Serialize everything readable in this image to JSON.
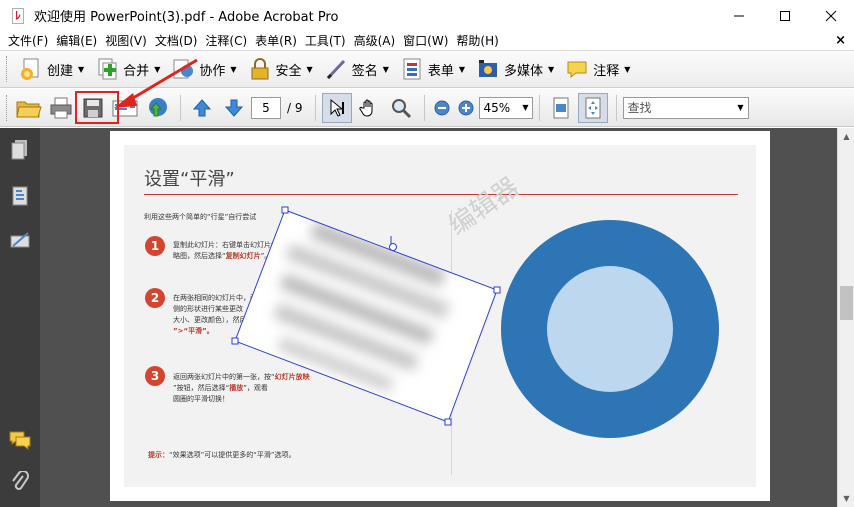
{
  "window": {
    "title": "欢迎使用 PowerPoint(3).pdf - Adobe Acrobat Pro",
    "minimize_icon": "minimize-icon",
    "maximize_icon": "maximize-icon",
    "close_icon": "close-icon"
  },
  "menu": {
    "items": [
      "文件(F)",
      "编辑(E)",
      "视图(V)",
      "文档(D)",
      "注释(C)",
      "表单(R)",
      "工具(T)",
      "高级(A)",
      "窗口(W)",
      "帮助(H)"
    ],
    "close_symbol": "×"
  },
  "toolbar1": {
    "items": [
      {
        "label": "创建",
        "icon": "create-icon"
      },
      {
        "label": "合并",
        "icon": "combine-icon"
      },
      {
        "label": "协作",
        "icon": "collaborate-icon"
      },
      {
        "label": "安全",
        "icon": "lock-icon"
      },
      {
        "label": "签名",
        "icon": "pen-icon"
      },
      {
        "label": "表单",
        "icon": "form-icon"
      },
      {
        "label": "多媒体",
        "icon": "multimedia-icon"
      },
      {
        "label": "注释",
        "icon": "comment-icon"
      }
    ]
  },
  "toolbar2": {
    "page_current": "5",
    "page_total": "/ 9",
    "zoom": "45%",
    "find_placeholder": "查找"
  },
  "slide": {
    "title": "设置“平滑”",
    "subtitle": "利用这些两个简单的“行星”自行尝试",
    "steps": [
      {
        "num": "1",
        "text_a": "复制此幻灯片：右键单击幻灯片缩",
        "text_b": "略图，然后选择“",
        "red": "复制幻灯片",
        "text_c": "”。"
      },
      {
        "num": "2",
        "text_a": "在两张相同的幻灯片中，改变右",
        "text_b": "侧的形状进行某些更改（例如更改",
        "text_c": "大小、更改颜色），然后选择“切",
        "red": "换",
        "text_d": "”>“平滑”。"
      },
      {
        "num": "3",
        "text_a": "返回两张幻灯片中的第一张，按“",
        "red1": "幻灯片放映",
        "text_b": "”按钮，然后选择“",
        "red2": "播放",
        "text_c": "”，观看",
        "text_d": "圆圈的平滑切换！"
      }
    ],
    "tip_label": "提示：",
    "tip_text": "“效果选项”可以提供更多的“平滑”选项。",
    "watermark": "编辑器"
  },
  "colors": {
    "accent_red": "#c0392b",
    "donut_outer": "#2e75b6",
    "donut_inner": "#bdd7ee",
    "highlight_red": "#e0241b"
  }
}
